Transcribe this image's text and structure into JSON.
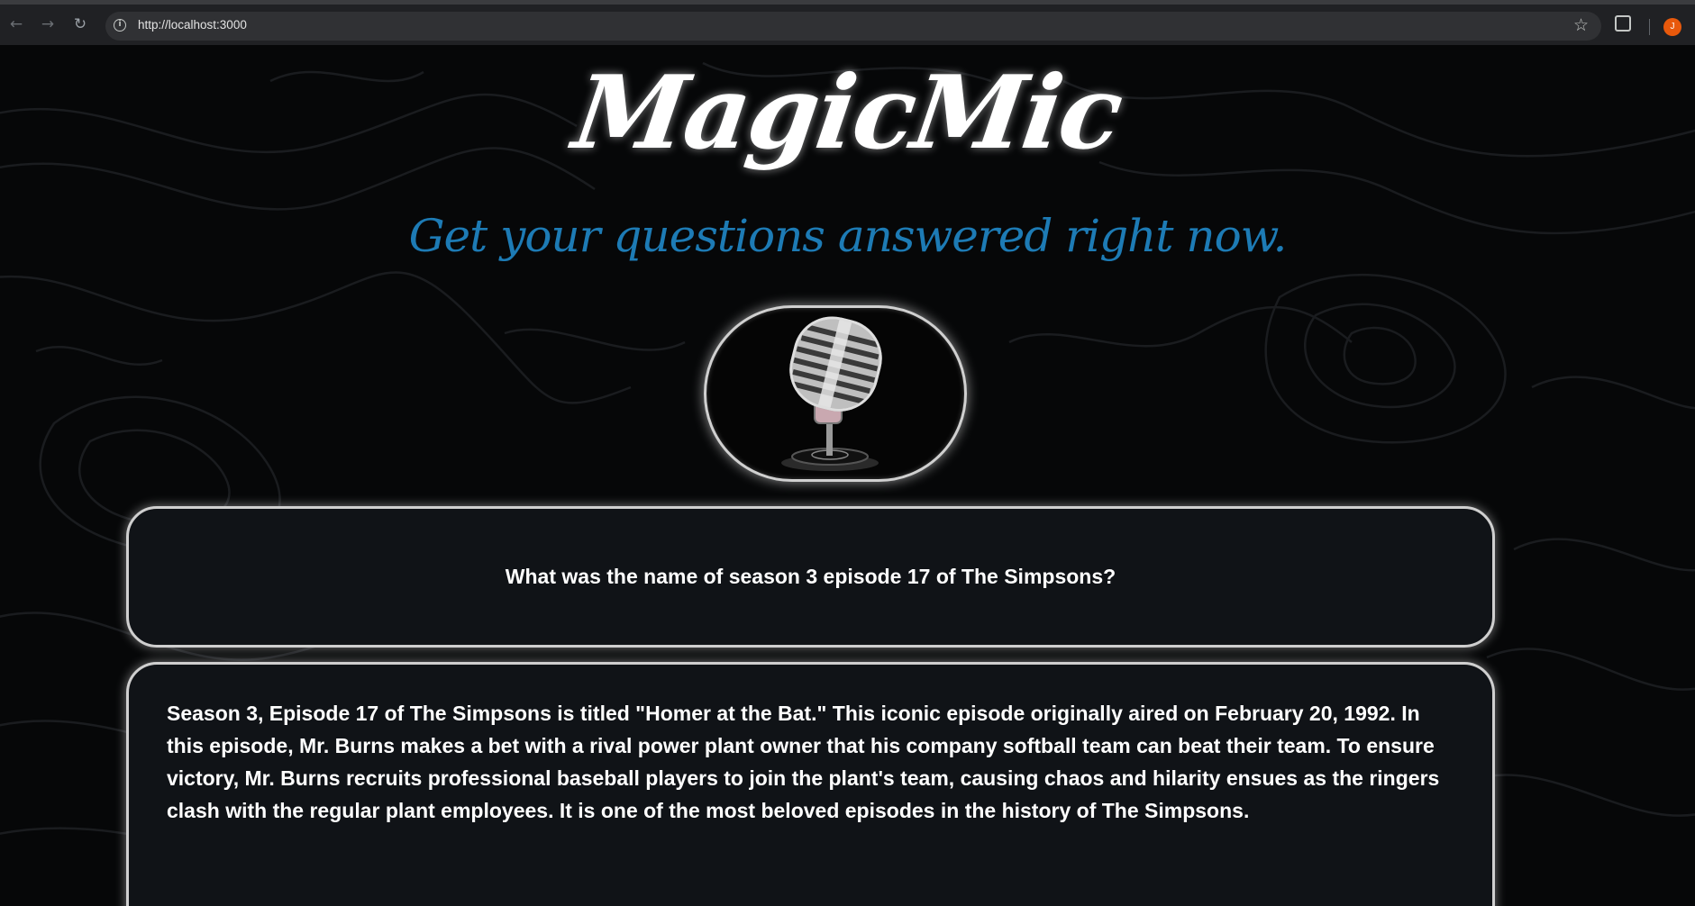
{
  "browser": {
    "url": "http://localhost:3000",
    "profile_initial": "J"
  },
  "header": {
    "brand": "MagicMic",
    "tagline": "Get your questions answered right now."
  },
  "conversation": {
    "question": "What was the name of season 3 episode 17 of The Simpsons?",
    "answer": "Season 3, Episode 17 of The Simpsons is titled \"Homer at the Bat.\" This iconic episode originally aired on February 20, 1992. In this episode, Mr. Burns makes a bet with a rival power plant owner that his company softball team can beat their team. To ensure victory, Mr. Burns recruits professional baseball players to join the plant's team, causing chaos and hilarity ensues as the ringers clash with the regular plant employees. It is one of the most beloved episodes in the history of The Simpsons."
  },
  "icons": {
    "back": "arrow-left-icon",
    "forward": "arrow-right-icon",
    "reload": "reload-icon",
    "site_info": "info-icon",
    "bookmark": "star-icon",
    "extensions": "puzzle-icon",
    "mic": "microphone-icon"
  },
  "colors": {
    "background": "#060708",
    "tagline": "#1d7bb5",
    "card_background": "#101317",
    "card_border": "#cfcfcf"
  }
}
